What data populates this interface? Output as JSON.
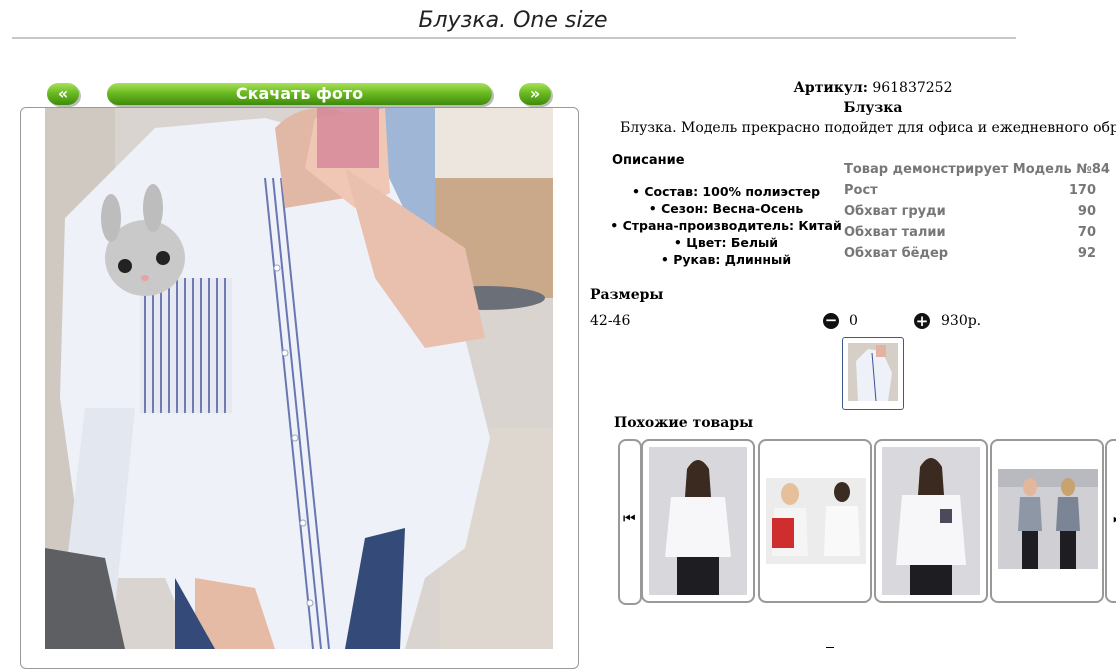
{
  "page": {
    "title": "Блузка. One size"
  },
  "gallery": {
    "prev_label": "«",
    "download_label": "Скачать фото",
    "next_label": "»"
  },
  "product": {
    "article_label": "Артикул:",
    "article_value": "961837252",
    "name": "Блузка",
    "description": "Блузка. Модель прекрасно подойдет для офиса и ежедневного образа."
  },
  "description_block": {
    "heading": "Описание",
    "items": [
      "Состав: 100% полиэстер",
      "Сезон: Весна-Осень",
      "Страна-производитель: Китай",
      "Цвет: Белый",
      "Рукав: Длинный"
    ]
  },
  "model": {
    "heading": "Товар демонстрирует Модель №84",
    "rows": [
      {
        "label": "Рост",
        "value": "170"
      },
      {
        "label": "Обхват груди",
        "value": "90"
      },
      {
        "label": "Обхват талии",
        "value": "70"
      },
      {
        "label": "Обхват бёдер",
        "value": "92"
      }
    ]
  },
  "sizes": {
    "heading": "Размеры",
    "size": "42-46",
    "minus_icon": "minus-circle-icon",
    "quantity": "0",
    "plus_icon": "plus-circle-icon",
    "price": "930р."
  },
  "similar": {
    "heading": "Похожие товары",
    "prev_icon": "skip-back-icon",
    "next_icon": "skip-forward-icon"
  },
  "colors": {
    "button_green": "#6cbb22",
    "frame_border": "#999999",
    "thumb_border": "#3b5a8a"
  }
}
